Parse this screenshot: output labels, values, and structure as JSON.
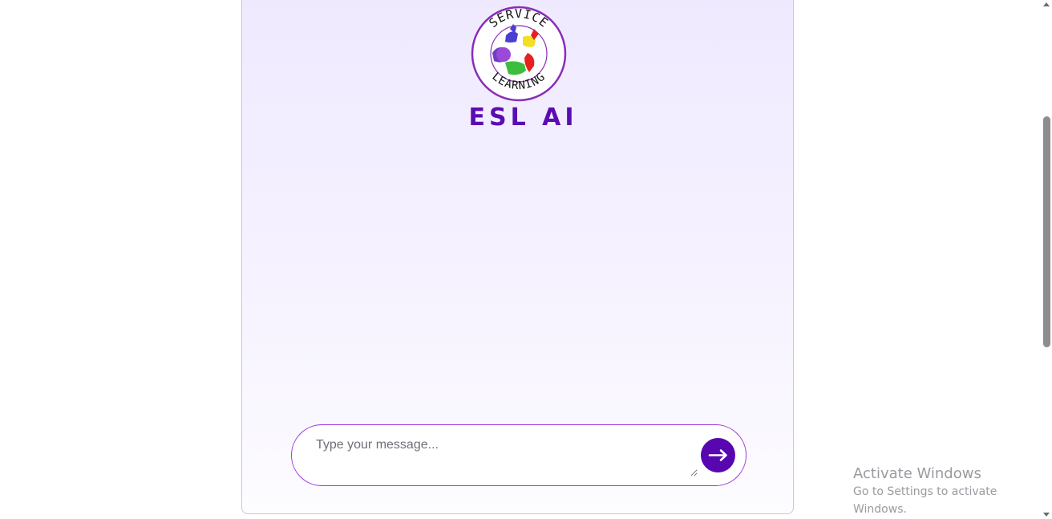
{
  "app": {
    "title": "ESL AI",
    "logo": {
      "text_top": "SERVICE",
      "text_bottom": "LEARNING"
    }
  },
  "composer": {
    "placeholder": "Type your message...",
    "value": "",
    "send_icon": "arrow-right-icon"
  },
  "colors": {
    "accent": "#5706b0",
    "title": "#5a0db3",
    "input_border": "#9b38d8",
    "background_top": "#efe9ff",
    "background_bottom": "#fdfcff"
  },
  "os_watermark": {
    "title": "Activate Windows",
    "subtitle": "Go to Settings to activate Windows."
  }
}
